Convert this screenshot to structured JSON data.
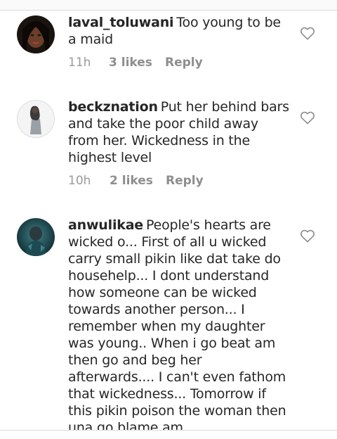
{
  "comments": [
    {
      "username": "laval_toluwani",
      "text": "Too young to be a maid",
      "time": "11h",
      "likes": "3 likes",
      "reply": "Reply"
    },
    {
      "username": "beckznation",
      "text": "Put her behind bars and take the poor child away from her. Wickedness in the highest level",
      "time": "10h",
      "likes": "2 likes",
      "reply": "Reply"
    },
    {
      "username": "anwulikae",
      "text": "People's hearts are wicked o... First of all u wicked carry small pikin like dat take do househelp... I dont understand how someone can be wicked towards another person... I remember when my daughter was young.. When i go beat am then go and beg her afterwards.... I can't even fathom that wickedness... Tomorrow if this pikin poison the woman then una go blame am",
      "time": "",
      "likes": "",
      "reply": ""
    }
  ],
  "icons": {
    "like": "heart-outline-icon"
  },
  "colors": {
    "text": "#262626",
    "meta": "#8e8e8e",
    "divider": "#dbdbdb"
  }
}
